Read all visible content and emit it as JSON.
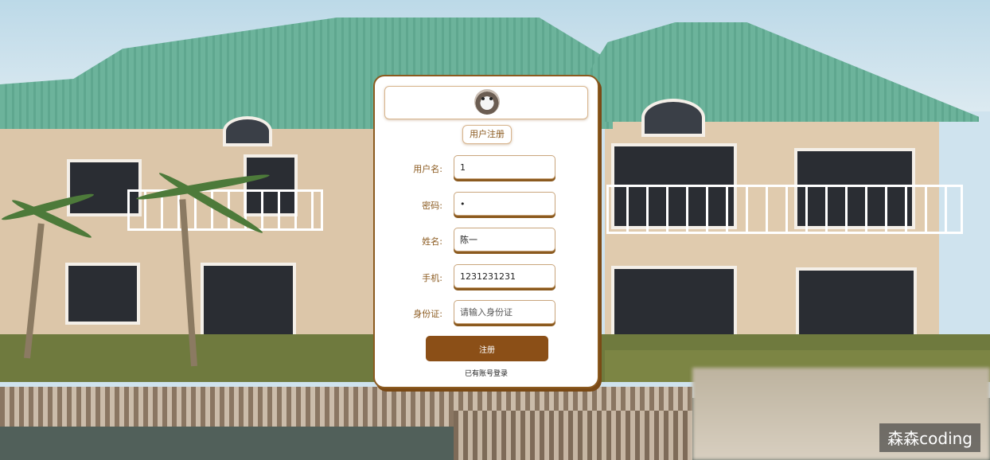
{
  "form": {
    "title": "用户注册",
    "fields": [
      {
        "label": "用户名:",
        "value": "1",
        "placeholder": ""
      },
      {
        "label": "密码:",
        "value": "•",
        "placeholder": ""
      },
      {
        "label": "姓名:",
        "value": "陈一",
        "placeholder": ""
      },
      {
        "label": "手机:",
        "value": "1231231231",
        "placeholder": ""
      },
      {
        "label": "身份证:",
        "value": "",
        "placeholder": "请输入身份证"
      }
    ],
    "submit_label": "注册",
    "login_link": "已有账号登录"
  },
  "watermark": "森森coding",
  "colors": {
    "accent": "#8b4f17",
    "card_border": "#8b5a1f",
    "card_bg": "#ffffff"
  }
}
